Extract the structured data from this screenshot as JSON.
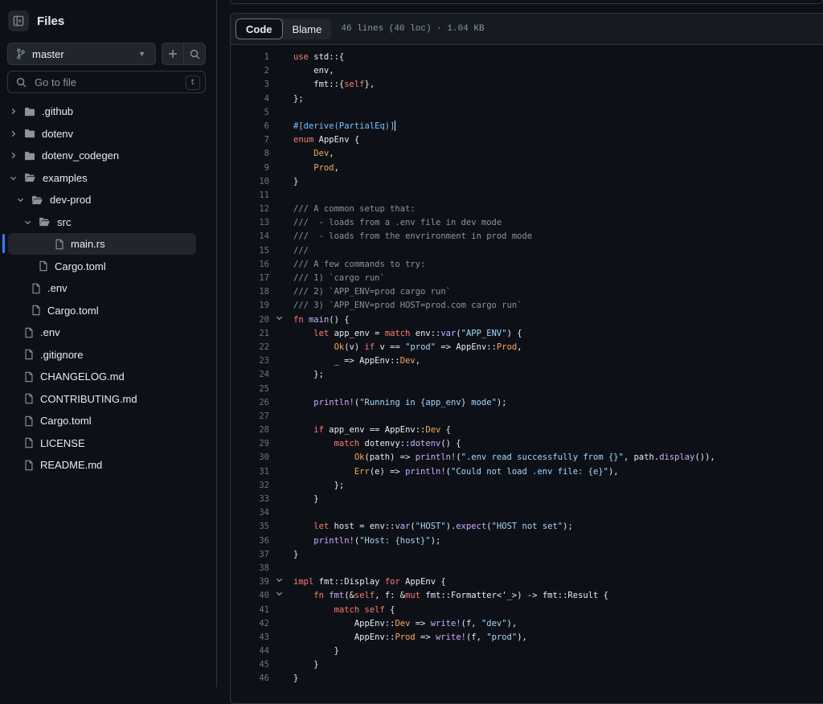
{
  "sidebar": {
    "title": "Files",
    "branch": "master",
    "search_placeholder": "Go to file",
    "search_shortcut": "t",
    "tree": [
      {
        "label": ".github",
        "type": "folder",
        "depth": 0,
        "expanded": false
      },
      {
        "label": "dotenv",
        "type": "folder",
        "depth": 0,
        "expanded": false
      },
      {
        "label": "dotenv_codegen",
        "type": "folder",
        "depth": 0,
        "expanded": false
      },
      {
        "label": "examples",
        "type": "folder",
        "depth": 0,
        "expanded": true
      },
      {
        "label": "dev-prod",
        "type": "folder",
        "depth": 1,
        "expanded": true
      },
      {
        "label": "src",
        "type": "folder",
        "depth": 2,
        "expanded": true
      },
      {
        "label": "main.rs",
        "type": "file",
        "depth": 3,
        "selected": true
      },
      {
        "label": "Cargo.toml",
        "type": "file",
        "depth": 2
      },
      {
        "label": ".env",
        "type": "file",
        "depth": 1
      },
      {
        "label": "Cargo.toml",
        "type": "file",
        "depth": 1
      },
      {
        "label": ".env",
        "type": "file",
        "depth": 0
      },
      {
        "label": ".gitignore",
        "type": "file",
        "depth": 0
      },
      {
        "label": "CHANGELOG.md",
        "type": "file",
        "depth": 0
      },
      {
        "label": "CONTRIBUTING.md",
        "type": "file",
        "depth": 0
      },
      {
        "label": "Cargo.toml",
        "type": "file",
        "depth": 0
      },
      {
        "label": "LICENSE",
        "type": "file",
        "depth": 0
      },
      {
        "label": "README.md",
        "type": "file",
        "depth": 0
      }
    ]
  },
  "file_header": {
    "tab_code": "Code",
    "tab_blame": "Blame",
    "meta": "46 lines (40 loc) · 1.04 KB"
  },
  "code": {
    "fold_lines": [
      20,
      39,
      40
    ],
    "lines": [
      "use std::{",
      "    env,",
      "    fmt::{self},",
      "};",
      "",
      "#[derive(PartialEq)]",
      "enum AppEnv {",
      "    Dev,",
      "    Prod,",
      "}",
      "",
      "/// A common setup that:",
      "///  - loads from a .env file in dev mode",
      "///  - loads from the envrironment in prod mode",
      "///",
      "/// A few commands to try:",
      "/// 1) `cargo run`",
      "/// 2) `APP_ENV=prod cargo run`",
      "/// 3) `APP_ENV=prod HOST=prod.com cargo run`",
      "fn main() {",
      "    let app_env = match env::var(\"APP_ENV\") {",
      "        Ok(v) if v == \"prod\" => AppEnv::Prod,",
      "        _ => AppEnv::Dev,",
      "    };",
      "",
      "    println!(\"Running in {app_env} mode\");",
      "",
      "    if app_env == AppEnv::Dev {",
      "        match dotenvy::dotenv() {",
      "            Ok(path) => println!(\".env read successfully from {}\", path.display()),",
      "            Err(e) => println!(\"Could not load .env file: {e}\"),",
      "        };",
      "    }",
      "",
      "    let host = env::var(\"HOST\").expect(\"HOST not set\");",
      "    println!(\"Host: {host}\");",
      "}",
      "",
      "impl fmt::Display for AppEnv {",
      "    fn fmt(&self, f: &mut fmt::Formatter<'_>) -> fmt::Result {",
      "        match self {",
      "            AppEnv::Dev => write!(f, \"dev\"),",
      "            AppEnv::Prod => write!(f, \"prod\"),",
      "        }",
      "    }",
      "}"
    ]
  },
  "colors": {
    "background": "#0d1117",
    "keyword": "#ff7b72",
    "string": "#a5d6ff",
    "function": "#d2a8ff",
    "comment": "#8b949e",
    "type": "#ffa657",
    "selection_accent": "#2f81f7"
  }
}
